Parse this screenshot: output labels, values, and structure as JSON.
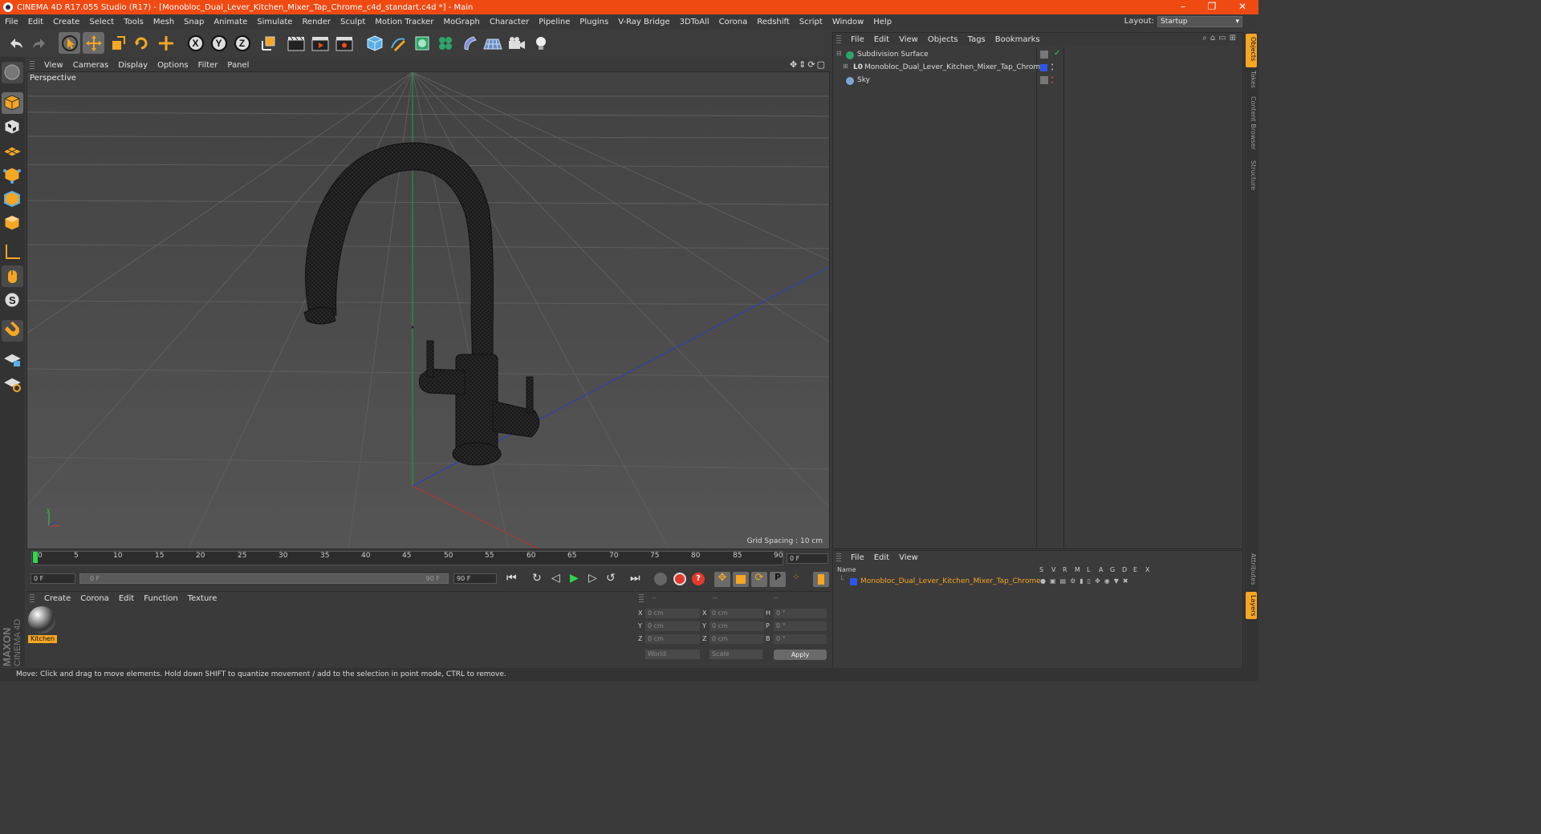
{
  "window": {
    "title": "CINEMA 4D R17.055 Studio (R17) - [Monobloc_Dual_Lever_Kitchen_Mixer_Tap_Chrome_c4d_standart.c4d *] - Main",
    "minimize": "–",
    "restore": "❐",
    "close": "✕"
  },
  "menu": [
    "File",
    "Edit",
    "Create",
    "Select",
    "Tools",
    "Mesh",
    "Snap",
    "Animate",
    "Simulate",
    "Render",
    "Sculpt",
    "Motion Tracker",
    "MoGraph",
    "Character",
    "Pipeline",
    "Plugins",
    "V-Ray Bridge",
    "3DToAll",
    "Corona",
    "Redshift",
    "Script",
    "Window",
    "Help"
  ],
  "layout": {
    "label": "Layout:",
    "value": "Startup"
  },
  "viewport": {
    "menu": [
      "View",
      "Cameras",
      "Display",
      "Options",
      "Filter",
      "Panel"
    ],
    "label": "Perspective",
    "grid_spacing": "Grid Spacing : 10 cm"
  },
  "timeline": {
    "ticks": [
      "0",
      "5",
      "10",
      "15",
      "20",
      "25",
      "30",
      "35",
      "40",
      "45",
      "50",
      "55",
      "60",
      "65",
      "70",
      "75",
      "80",
      "85",
      "90"
    ],
    "current": "0 F"
  },
  "transport": {
    "start": "0 F",
    "range_start": "0 F",
    "range_end": "90 F",
    "end": "90 F"
  },
  "materials": {
    "menu": [
      "Create",
      "Corona",
      "Edit",
      "Function",
      "Texture"
    ],
    "items": [
      {
        "name": "Kitchen"
      }
    ]
  },
  "coords": {
    "headers": [
      "--",
      "--",
      "--"
    ],
    "rows": [
      {
        "a": "X",
        "v1": "0 cm",
        "b": "X",
        "v2": "0 cm",
        "c": "H",
        "v3": "0 °"
      },
      {
        "a": "Y",
        "v1": "0 cm",
        "b": "Y",
        "v2": "0 cm",
        "c": "P",
        "v3": "0 °"
      },
      {
        "a": "Z",
        "v1": "0 cm",
        "b": "Z",
        "v2": "0 cm",
        "c": "B",
        "v3": "0 °"
      }
    ],
    "world": "World",
    "scale": "Scale",
    "apply": "Apply"
  },
  "objects": {
    "menu": [
      "File",
      "Edit",
      "View",
      "Objects",
      "Tags",
      "Bookmarks"
    ],
    "items": [
      {
        "name": "Subdivision Surface"
      },
      {
        "name": "Monobloc_Dual_Lever_Kitchen_Mixer_Tap_Chrome"
      },
      {
        "name": "Sky"
      }
    ]
  },
  "layers": {
    "menu": [
      "File",
      "Edit",
      "View"
    ],
    "name_header": "Name",
    "flags": [
      "S",
      "V",
      "R",
      "M",
      "L",
      "A",
      "G",
      "D",
      "E",
      "X"
    ],
    "row": "Monobloc_Dual_Lever_Kitchen_Mixer_Tap_Chrome"
  },
  "sidetabs": [
    "Objects",
    "Takes",
    "Content Browser",
    "Structure"
  ],
  "sidetabs_bottom": [
    "Attributes",
    "Layers"
  ],
  "brand": {
    "maxon": "MAXON",
    "cinema": "CINEMA 4D"
  },
  "status": "Move: Click and drag to move elements. Hold down SHIFT to quantize movement / add to the selection in point mode, CTRL to remove."
}
